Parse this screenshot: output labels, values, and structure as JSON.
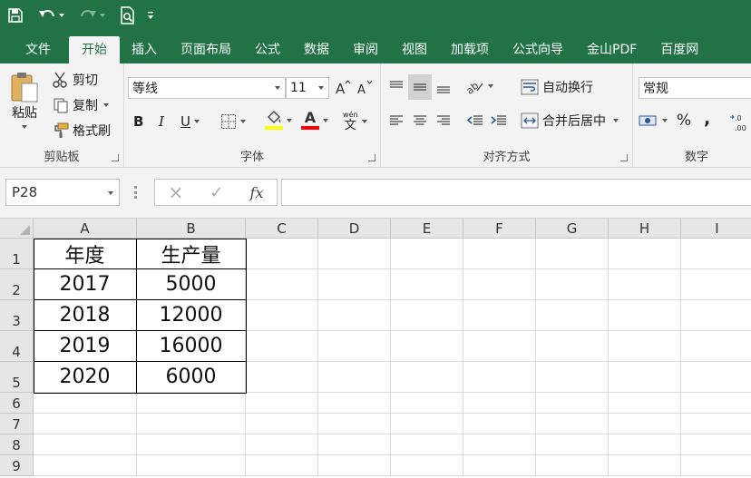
{
  "tabs": [
    "文件",
    "开始",
    "插入",
    "页面布局",
    "公式",
    "数据",
    "审阅",
    "视图",
    "加载项",
    "公式向导",
    "金山PDF",
    "百度网"
  ],
  "active_tab": "开始",
  "clipboard": {
    "paste": "粘贴",
    "cut": "剪切",
    "copy": "复制",
    "format_painter": "格式刷",
    "label": "剪贴板"
  },
  "font": {
    "name": "等线",
    "size": "11",
    "bold": "B",
    "italic": "I",
    "underline": "U",
    "font_color_letter": "A",
    "phonetic": "wén",
    "phonetic_char": "文",
    "label": "字体",
    "fill_color": "#ffff00",
    "text_color": "#ff0000"
  },
  "alignment": {
    "wrap": "自动换行",
    "merge": "合并后居中",
    "label": "对齐方式"
  },
  "number": {
    "format": "常规",
    "percent": "%",
    "comma": ",",
    "label": "数字"
  },
  "formula_bar": {
    "name_box": "P28",
    "cancel": "×",
    "enter": "✓",
    "fx": "fx",
    "formula": ""
  },
  "columns": [
    "A",
    "B",
    "C",
    "D",
    "E",
    "F",
    "G",
    "H",
    "I"
  ],
  "rows": [
    "1",
    "2",
    "3",
    "4",
    "5",
    "6",
    "7",
    "8",
    "9"
  ],
  "table": {
    "header": [
      "年度",
      "生产量"
    ],
    "data": [
      [
        "2017",
        "5000"
      ],
      [
        "2018",
        "12000"
      ],
      [
        "2019",
        "16000"
      ],
      [
        "2020",
        "6000"
      ]
    ]
  },
  "colors": {
    "excel_green": "#217346",
    "ribbon_bg": "#f3f3f3"
  }
}
